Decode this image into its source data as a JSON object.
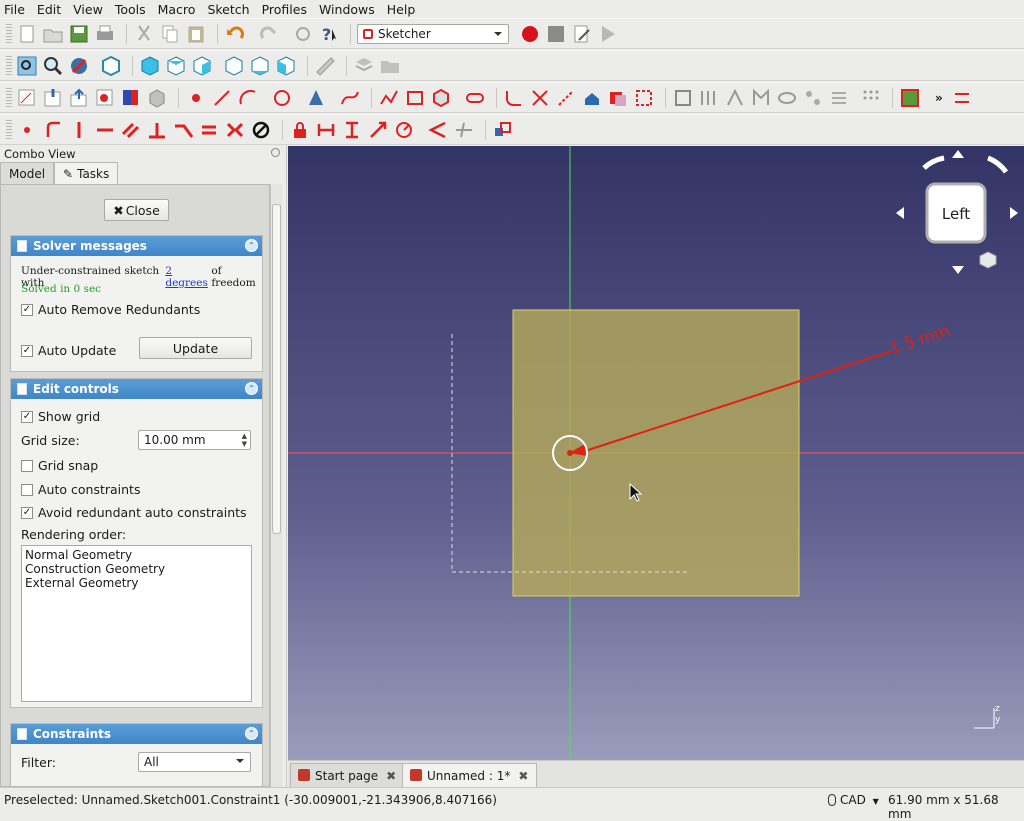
{
  "menu": [
    "File",
    "Edit",
    "View",
    "Tools",
    "Macro",
    "Sketch",
    "Profiles",
    "Windows",
    "Help"
  ],
  "workbench": {
    "selected": "Sketcher"
  },
  "panel": {
    "title": "Combo View",
    "tabs": [
      "Model",
      "Tasks"
    ],
    "close_label": "Close",
    "solver": {
      "title": "Solver messages",
      "msg_prefix": "Under-constrained sketch with ",
      "msg_link": "2 degrees",
      "msg_suffix": " of freedom",
      "solved": "Solved in 0 sec",
      "auto_remove": "Auto Remove Redundants",
      "auto_update": "Auto Update",
      "update_label": "Update"
    },
    "edit": {
      "title": "Edit controls",
      "show_grid": "Show grid",
      "grid_size_label": "Grid size:",
      "grid_size_value": "10.00 mm",
      "grid_snap": "Grid snap",
      "auto_constraints": "Auto constraints",
      "avoid_redundant": "Avoid redundant auto constraints",
      "rendering_label": "Rendering order:",
      "rendering_items": [
        "Normal Geometry",
        "Construction Geometry",
        "External Geometry"
      ]
    },
    "constraints": {
      "title": "Constraints",
      "filter_label": "Filter:",
      "filter_value": "All"
    }
  },
  "viewport": {
    "nav_label": "Left",
    "dimension": "1.5 mm",
    "axis_z": "z",
    "axis_y": "y"
  },
  "doc_tabs": [
    "Start page",
    "Unnamed : 1*"
  ],
  "status": {
    "preselected": "Preselected: Unnamed.Sketch001.Constraint1 (-30.009001,-21.343906,8.407166)",
    "nav_style": "CAD",
    "dimensions": "61.90 mm x 51.68 mm"
  },
  "colors": {
    "accent": "#4a90d9",
    "sketch_face": "#b5a85a",
    "constraint": "#e02010",
    "x_axis": "#ff5050",
    "y_axis": "#50e050"
  }
}
